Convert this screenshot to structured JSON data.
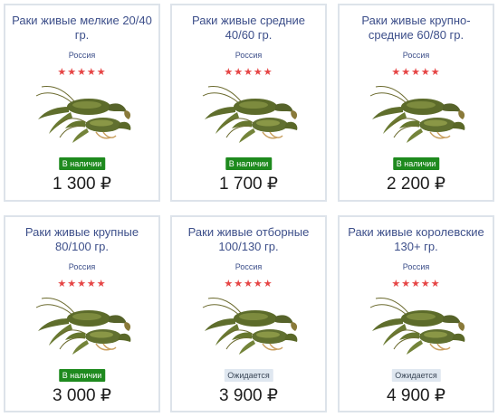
{
  "products": [
    {
      "title": "Раки живые мелкие 20/40 гр.",
      "country": "Россия",
      "stars": "★★★★★",
      "status": "В наличии",
      "status_type": "in-stock",
      "price": "1 300 ₽"
    },
    {
      "title": "Раки живые средние 40/60 гр.",
      "country": "Россия",
      "stars": "★★★★★",
      "status": "В наличии",
      "status_type": "in-stock",
      "price": "1 700 ₽"
    },
    {
      "title": "Раки живые крупно-средние 60/80 гр.",
      "country": "Россия",
      "stars": "★★★★★",
      "status": "В наличии",
      "status_type": "in-stock",
      "price": "2 200 ₽"
    },
    {
      "title": "Раки живые крупные 80/100 гр.",
      "country": "Россия",
      "stars": "★★★★★",
      "status": "В наличии",
      "status_type": "in-stock",
      "price": "3 000 ₽"
    },
    {
      "title": "Раки живые отборные 100/130 гр.",
      "country": "Россия",
      "stars": "★★★★★",
      "status": "Ожидается",
      "status_type": "expected",
      "price": "3 900 ₽"
    },
    {
      "title": "Раки живые королевские 130+ гр.",
      "country": "Россия",
      "stars": "★★★★★",
      "status": "Ожидается",
      "status_type": "expected",
      "price": "4 900 ₽"
    }
  ],
  "colors": {
    "title": "#3d4f8a",
    "star": "#e64545",
    "in_stock_bg": "#1e8a1e",
    "expected_bg": "#dfe7f0",
    "card_border": "#dde3ea"
  }
}
